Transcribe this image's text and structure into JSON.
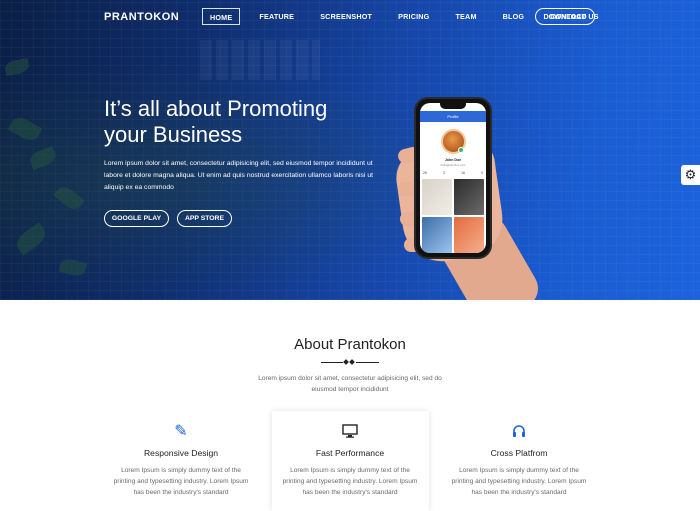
{
  "nav": {
    "brand": "PRANTOKON",
    "items": [
      "HOME",
      "FEATURE",
      "SCREENSHOT",
      "PRICING",
      "TEAM",
      "BLOG",
      "CONTACT US"
    ],
    "active": "HOME",
    "download_label": "DOWNLOAD"
  },
  "hero": {
    "headline_line1": "It’s all about Promoting",
    "headline_line2": "your Business",
    "intro": "Lorem ipsum dolor sit amet, consectetur adipisicing elit, sed eiusmod tempor incididunt ut labore et dolore magna aliqua. Ut enim ad quis nostrud exercitation ullamco laboris nisi ut aliquip ex ea commodo",
    "buttons": {
      "google_play": "GOOGLE PLAY",
      "app_store": "APP STORE"
    }
  },
  "phone": {
    "header": "Profile",
    "name": "John Doe",
    "email": "hello@johndoe.com",
    "stats": [
      "26",
      "3",
      "16",
      "0"
    ]
  },
  "about": {
    "title": "About Prantokon",
    "subtitle": "Lorem ipsum dolor sit amet, consectetur adipisicing elit, sed do eiusmod tempor incididunt",
    "features": [
      {
        "icon": "pencil-ruler-icon",
        "title": "Responsive Design",
        "text": "Lorem Ipsum is simply dummy text of the printing and typesetting industry. Lorem Ipsum has been the industry's standard"
      },
      {
        "icon": "monitor-icon",
        "title": "Fast Performance",
        "text": "Lorem Ipsum is simply dummy text of the printing and typesetting industry. Lorem Ipsum has been the industry's standard"
      },
      {
        "icon": "headset-icon",
        "title": "Cross Platfrom",
        "text": "Lorem Ipsum is simply dummy text of the printing and typesetting industry. Lorem Ipsum has been the industry's standard"
      }
    ]
  },
  "colors": {
    "accent": "#1e63d6",
    "hero_dark": "#0b1f45",
    "hero_light": "#1d63dc"
  },
  "settings_icon": "gear-icon"
}
